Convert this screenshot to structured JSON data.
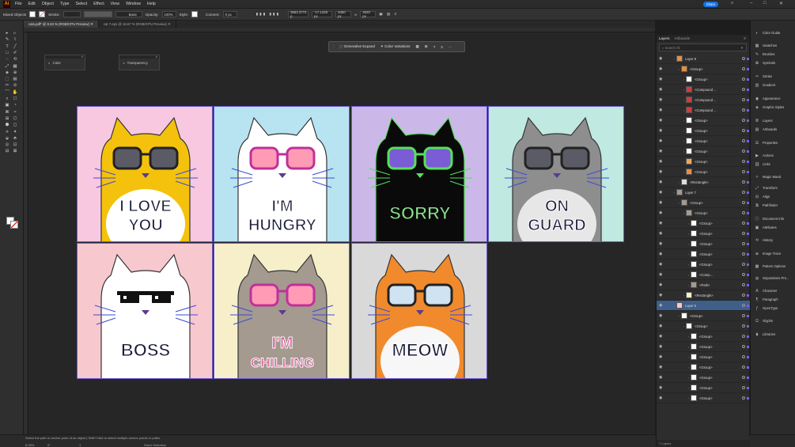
{
  "menu": {
    "logo": "Ai",
    "items": [
      "File",
      "Edit",
      "Object",
      "Type",
      "Select",
      "Effect",
      "View",
      "Window",
      "Help"
    ],
    "share": "Share"
  },
  "control": {
    "mode": "Mixed Objects",
    "stroke_label": "Stroke:",
    "stroke_profile": "Basic",
    "opacity_label": "Opacity:",
    "opacity_value": "100%",
    "style_label": "Style:",
    "corners_label": "Corners:",
    "corners_value": "0 px",
    "x_value": "3663.3774 p",
    "y_value": "-17.1429 px",
    "w_value": "4060 px",
    "h_value": "4020 px"
  },
  "tabs": [
    {
      "label": "cats.pdf* @ 8.33 % (RGB/CPU Preview)",
      "active": true
    },
    {
      "label": "cat 7.eps @ 16.67 % (RGB/CPU Preview)",
      "active": false
    }
  ],
  "floating": {
    "color": "Color",
    "transparency": "Transparency"
  },
  "context_bar": {
    "generative_expand": "Generative Expand",
    "color_variations": "Color Variations"
  },
  "artboards": [
    {
      "caption_lines": [
        "I LOVE",
        "YOU"
      ],
      "bg": "#f7c8e0",
      "cat": "#f4c20d",
      "belly": "#ffffff",
      "glasses": "dark"
    },
    {
      "caption_lines": [
        "I'M",
        "HUNGRY"
      ],
      "bg": "#b7e4f0",
      "cat": "#ffffff",
      "belly": "#ffffff",
      "glasses": "pink"
    },
    {
      "caption_lines": [
        "SORRY"
      ],
      "bg": "#cbb8e8",
      "cat": "#0a0a0a",
      "belly": "#0a0a0a",
      "glasses": "purple"
    },
    {
      "caption_lines": [
        "ON",
        "GUARD"
      ],
      "bg": "#bfe9e1",
      "cat": "#8e8e8e",
      "belly": "#e7e7e7",
      "glasses": "dark"
    },
    {
      "caption_lines": [
        "BOSS"
      ],
      "bg": "#f8c8cf",
      "cat": "#ffffff",
      "belly": "#ffffff",
      "glasses": "pixel"
    },
    {
      "caption_lines": [
        "I'M",
        "CHILLING"
      ],
      "bg": "#f6efc9",
      "cat": "#a49a8f",
      "belly": "#a49a8f",
      "glasses": "pink"
    },
    {
      "caption_lines": [
        "MEOW"
      ],
      "bg": "#d9d9d9",
      "cat": "#f08a2c",
      "belly": "#f7f7f7",
      "glasses": "clear"
    }
  ],
  "status": {
    "zoom": "8.33%",
    "hint": "Select the path or anchor point of an object | Shift+Click to select multiple anchor points or paths",
    "tool": "Direct Selection",
    "angle": "0°",
    "artboard_no": "1"
  },
  "layers": {
    "tabs": [
      "Layers",
      "Artboards"
    ],
    "search_placeholder": "Search All",
    "count": "7 Layers",
    "rows": [
      {
        "name": "Layer 8",
        "indent": 0,
        "thumb": "#e58f44"
      },
      {
        "name": "<Group>",
        "indent": 1,
        "thumb": "#e58f44"
      },
      {
        "name": "<Group>",
        "indent": 2,
        "thumb": "#ffffff"
      },
      {
        "name": "<Compound ...",
        "indent": 2,
        "thumb": "#d63a3a"
      },
      {
        "name": "<Compound ...",
        "indent": 2,
        "thumb": "#d63a3a"
      },
      {
        "name": "<Compound ...",
        "indent": 2,
        "thumb": "#d63a3a"
      },
      {
        "name": "<Group>",
        "indent": 2,
        "thumb": "#ffffff"
      },
      {
        "name": "<Group>",
        "indent": 2,
        "thumb": "#ffffff"
      },
      {
        "name": "<Group>",
        "indent": 2,
        "thumb": "#ffffff"
      },
      {
        "name": "<Group>",
        "indent": 2,
        "thumb": "#ffffff"
      },
      {
        "name": "<Group>",
        "indent": 2,
        "thumb": "#f2a65a"
      },
      {
        "name": "<Group>",
        "indent": 2,
        "thumb": "#e58f44"
      },
      {
        "name": "<Rectangle>",
        "indent": 1,
        "thumb": "#dddddd"
      },
      {
        "name": "Layer 7",
        "indent": 0,
        "thumb": "#a49a8f"
      },
      {
        "name": "<Group>",
        "indent": 1,
        "thumb": "#a49a8f"
      },
      {
        "name": "<Group>",
        "indent": 2,
        "thumb": "#a49a8f"
      },
      {
        "name": "<Group>",
        "indent": 3,
        "thumb": "#ffffff"
      },
      {
        "name": "<Group>",
        "indent": 3,
        "thumb": "#ffffff"
      },
      {
        "name": "<Group>",
        "indent": 3,
        "thumb": "#ffffff"
      },
      {
        "name": "<Group>",
        "indent": 3,
        "thumb": "#ffffff"
      },
      {
        "name": "<Group>",
        "indent": 3,
        "thumb": "#ffffff"
      },
      {
        "name": "<Comp...",
        "indent": 3,
        "thumb": "#ffffff"
      },
      {
        "name": "<Path>",
        "indent": 3,
        "thumb": "#a49a8f"
      },
      {
        "name": "<Rectangle>",
        "indent": 2,
        "thumb": "#f6efc9"
      },
      {
        "name": "Layer 6",
        "indent": 0,
        "thumb": "#f8c8cf",
        "selected": true
      },
      {
        "name": "<Group>",
        "indent": 1,
        "thumb": "#ffffff"
      },
      {
        "name": "<Group>",
        "indent": 2,
        "thumb": "#ffffff"
      },
      {
        "name": "<Group>",
        "indent": 3,
        "thumb": "#ffffff"
      },
      {
        "name": "<Group>",
        "indent": 3,
        "thumb": "#ffffff"
      },
      {
        "name": "<Group>",
        "indent": 3,
        "thumb": "#ffffff"
      },
      {
        "name": "<Group>",
        "indent": 3,
        "thumb": "#ffffff"
      },
      {
        "name": "<Group>",
        "indent": 3,
        "thumb": "#ffffff"
      },
      {
        "name": "<Group>",
        "indent": 3,
        "thumb": "#ffffff"
      },
      {
        "name": "<Group>",
        "indent": 3,
        "thumb": "#ffffff"
      }
    ]
  },
  "right_panels": [
    {
      "label": "Color Guide",
      "icon": "color-guide-icon"
    },
    {
      "label": "Swatches",
      "icon": "swatches-icon"
    },
    {
      "label": "Brushes",
      "icon": "brushes-icon"
    },
    {
      "label": "Symbols",
      "icon": "symbols-icon"
    },
    {
      "label": "Stroke",
      "icon": "stroke-icon"
    },
    {
      "label": "Gradient",
      "icon": "gradient-icon"
    },
    {
      "label": "Appearance",
      "icon": "appearance-icon"
    },
    {
      "label": "Graphic Styles",
      "icon": "graphic-styles-icon"
    },
    {
      "label": "Layers",
      "icon": "layers-icon"
    },
    {
      "label": "Artboards",
      "icon": "artboards-icon"
    },
    {
      "label": "Properties",
      "icon": "properties-icon"
    },
    {
      "label": "Actions",
      "icon": "actions-icon"
    },
    {
      "label": "Links",
      "icon": "links-icon"
    },
    {
      "label": "Magic Wand",
      "icon": "magic-wand-icon"
    },
    {
      "label": "Transform",
      "icon": "transform-icon"
    },
    {
      "label": "Align",
      "icon": "align-icon"
    },
    {
      "label": "Pathfinder",
      "icon": "pathfinder-icon"
    },
    {
      "label": "Document Info",
      "icon": "document-info-icon"
    },
    {
      "label": "Attributes",
      "icon": "attributes-icon"
    },
    {
      "label": "History",
      "icon": "history-icon"
    },
    {
      "label": "Image Trace",
      "icon": "image-trace-icon"
    },
    {
      "label": "Pattern Options",
      "icon": "pattern-options-icon"
    },
    {
      "label": "Separations Pre...",
      "icon": "separations-icon"
    },
    {
      "label": "Character",
      "icon": "character-icon"
    },
    {
      "label": "Paragraph",
      "icon": "paragraph-icon"
    },
    {
      "label": "OpenType",
      "icon": "opentype-icon"
    },
    {
      "label": "Glyphs",
      "icon": "glyphs-icon"
    },
    {
      "label": "Libraries",
      "icon": "libraries-icon"
    }
  ]
}
